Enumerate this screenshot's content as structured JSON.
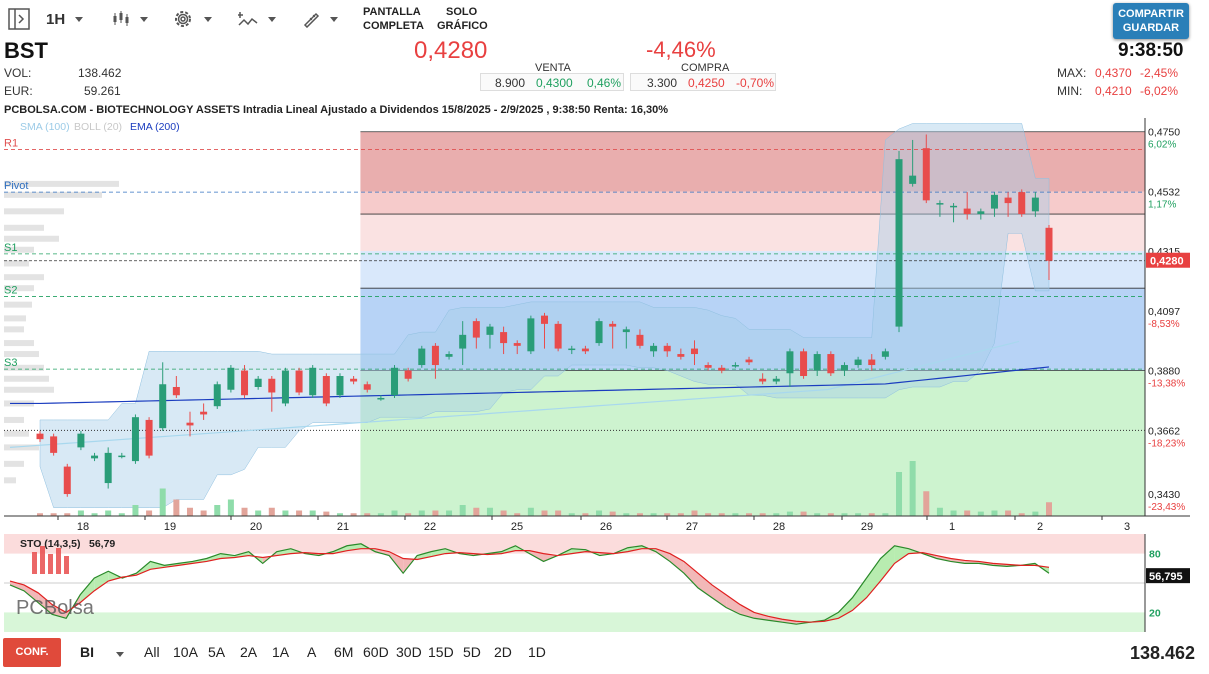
{
  "toolbar": {
    "timeframe": "1H",
    "mode_fullscreen": [
      "PANTALLA",
      "COMPLETA"
    ],
    "mode_chart_only": [
      "SOLO",
      "GRÁFICO"
    ],
    "share": [
      "COMPARTIR",
      "GUARDAR"
    ],
    "icons": [
      "panel-toggle-icon",
      "candles-icon",
      "gear-icon",
      "indicators-icon",
      "draw-pen-icon"
    ]
  },
  "quote": {
    "ticker": "BST",
    "vol_label": "VOL:",
    "vol": "138.462",
    "eur_label": "EUR:",
    "eur": "59.261",
    "price": "0,4280",
    "change": "-4,46%",
    "time": "9:38:50",
    "sell": {
      "label": "VENTA",
      "qty": "8.900",
      "price": "0,4300",
      "pct": "0,46%"
    },
    "buy": {
      "label": "COMPRA",
      "qty": "3.300",
      "price": "0,4250",
      "pct": "-0,70%"
    },
    "max_label": "MAX:",
    "max": "0,4370",
    "max_pct": "-2,45%",
    "min_label": "MIN:",
    "min": "0,4210",
    "min_pct": "-6,02%"
  },
  "chart_title": "PCBOLSA.COM - BIOTECHNOLOGY ASSETS Intradia Lineal Ajustado a Dividendos 15/8/2025 - 2/9/2025 , 9:38:50 Renta: 16,30%",
  "legend": {
    "sma": "SMA (100)",
    "boll": "BOLL (20)",
    "ema": "EMA (200)"
  },
  "pivots": [
    {
      "name": "R1",
      "value": 0.4685,
      "color": "#e05050"
    },
    {
      "name": "Pivot",
      "value": 0.453,
      "color": "#3070c0"
    },
    {
      "name": "S1",
      "value": 0.4305,
      "color": "#20a060"
    },
    {
      "name": "S2",
      "value": 0.415,
      "color": "#20a060"
    },
    {
      "name": "S3",
      "value": 0.3885,
      "color": "#20a060"
    }
  ],
  "chart_data": {
    "type": "candlestick",
    "ylim": [
      0.335,
      0.48
    ],
    "y_ticks": [
      {
        "value": 0.475,
        "label": "0,4750",
        "pct": "6,02%"
      },
      {
        "value": 0.4532,
        "label": "0,4532",
        "pct": "1,17%"
      },
      {
        "value": 0.4315,
        "label": "0,4315",
        "pct": ""
      },
      {
        "value": 0.4097,
        "label": "0,4097",
        "pct": "-8,53%"
      },
      {
        "value": 0.388,
        "label": "0,3880",
        "pct": "-13,38%"
      },
      {
        "value": 0.3662,
        "label": "0,3662",
        "pct": "-18,23%"
      },
      {
        "value": 0.343,
        "label": "0,3430",
        "pct": "-23,43%"
      }
    ],
    "last_price": {
      "value": 0.428,
      "label": "0,4280"
    },
    "x_ticks": [
      "18",
      "19",
      "20",
      "21",
      "22",
      "25",
      "26",
      "27",
      "28",
      "29",
      "1",
      "2",
      "3"
    ],
    "candles": [
      [
        0.365,
        0.363,
        0.366,
        0.362
      ],
      [
        0.364,
        0.358,
        0.365,
        0.357
      ],
      [
        0.353,
        0.343,
        0.354,
        0.342
      ],
      [
        0.36,
        0.365,
        0.366,
        0.359
      ],
      [
        0.356,
        0.357,
        0.358,
        0.355
      ],
      [
        0.347,
        0.358,
        0.36,
        0.345
      ],
      [
        0.357,
        0.357,
        0.358,
        0.356
      ],
      [
        0.355,
        0.371,
        0.372,
        0.354
      ],
      [
        0.37,
        0.357,
        0.371,
        0.356
      ],
      [
        0.367,
        0.383,
        0.391,
        0.366
      ],
      [
        0.382,
        0.379,
        0.386,
        0.378
      ],
      [
        0.369,
        0.368,
        0.373,
        0.364
      ],
      [
        0.373,
        0.372,
        0.376,
        0.37
      ],
      [
        0.375,
        0.383,
        0.384,
        0.374
      ],
      [
        0.381,
        0.389,
        0.39,
        0.38
      ],
      [
        0.388,
        0.379,
        0.39,
        0.378
      ],
      [
        0.382,
        0.385,
        0.386,
        0.381
      ],
      [
        0.385,
        0.38,
        0.386,
        0.373
      ],
      [
        0.376,
        0.388,
        0.389,
        0.375
      ],
      [
        0.388,
        0.38,
        0.389,
        0.379
      ],
      [
        0.379,
        0.389,
        0.39,
        0.378
      ],
      [
        0.386,
        0.376,
        0.387,
        0.375
      ],
      [
        0.379,
        0.386,
        0.387,
        0.378
      ],
      [
        0.385,
        0.384,
        0.386,
        0.383
      ],
      [
        0.383,
        0.381,
        0.384,
        0.38
      ],
      [
        0.378,
        0.378,
        0.379,
        0.377
      ],
      [
        0.379,
        0.389,
        0.39,
        0.378
      ],
      [
        0.388,
        0.385,
        0.389,
        0.384
      ],
      [
        0.39,
        0.396,
        0.397,
        0.389
      ],
      [
        0.397,
        0.39,
        0.398,
        0.385
      ],
      [
        0.393,
        0.394,
        0.395,
        0.392
      ],
      [
        0.396,
        0.401,
        0.406,
        0.39
      ],
      [
        0.406,
        0.4,
        0.407,
        0.396
      ],
      [
        0.401,
        0.404,
        0.405,
        0.396
      ],
      [
        0.402,
        0.398,
        0.404,
        0.394
      ],
      [
        0.398,
        0.397,
        0.399,
        0.394
      ],
      [
        0.395,
        0.407,
        0.408,
        0.394
      ],
      [
        0.408,
        0.405,
        0.409,
        0.396
      ],
      [
        0.405,
        0.396,
        0.406,
        0.395
      ],
      [
        0.396,
        0.396,
        0.397,
        0.394
      ],
      [
        0.396,
        0.395,
        0.397,
        0.394
      ],
      [
        0.398,
        0.406,
        0.407,
        0.397
      ],
      [
        0.405,
        0.404,
        0.406,
        0.396
      ],
      [
        0.402,
        0.403,
        0.404,
        0.396
      ],
      [
        0.401,
        0.397,
        0.403,
        0.396
      ],
      [
        0.395,
        0.397,
        0.398,
        0.393
      ],
      [
        0.397,
        0.395,
        0.398,
        0.393
      ],
      [
        0.394,
        0.393,
        0.396,
        0.392
      ],
      [
        0.396,
        0.394,
        0.399,
        0.39
      ],
      [
        0.39,
        0.389,
        0.391,
        0.388
      ],
      [
        0.389,
        0.388,
        0.39,
        0.387
      ],
      [
        0.39,
        0.39,
        0.391,
        0.389
      ],
      [
        0.392,
        0.391,
        0.393,
        0.39
      ],
      [
        0.385,
        0.384,
        0.387,
        0.383
      ],
      [
        0.384,
        0.385,
        0.386,
        0.383
      ],
      [
        0.387,
        0.395,
        0.396,
        0.382
      ],
      [
        0.395,
        0.386,
        0.396,
        0.385
      ],
      [
        0.388,
        0.394,
        0.395,
        0.386
      ],
      [
        0.394,
        0.387,
        0.395,
        0.386
      ],
      [
        0.388,
        0.39,
        0.391,
        0.386
      ],
      [
        0.39,
        0.392,
        0.393,
        0.389
      ],
      [
        0.392,
        0.39,
        0.394,
        0.388
      ],
      [
        0.393,
        0.395,
        0.396,
        0.392
      ],
      [
        0.404,
        0.465,
        0.468,
        0.402
      ],
      [
        0.456,
        0.459,
        0.472,
        0.455
      ],
      [
        0.469,
        0.45,
        0.474,
        0.449
      ],
      [
        0.449,
        0.449,
        0.45,
        0.444
      ],
      [
        0.448,
        0.448,
        0.449,
        0.442
      ],
      [
        0.447,
        0.445,
        0.453,
        0.443
      ],
      [
        0.445,
        0.446,
        0.447,
        0.443
      ],
      [
        0.447,
        0.452,
        0.453,
        0.444
      ],
      [
        0.451,
        0.449,
        0.453,
        0.444
      ],
      [
        0.453,
        0.445,
        0.454,
        0.444
      ],
      [
        0.446,
        0.451,
        0.453,
        0.444
      ],
      [
        0.44,
        0.428,
        0.441,
        0.421
      ]
    ],
    "volume": [
      0.05,
      0.05,
      0.05,
      0.1,
      0.05,
      0.1,
      0.05,
      0.2,
      0.1,
      0.5,
      0.3,
      0.15,
      0.1,
      0.2,
      0.3,
      0.15,
      0.1,
      0.15,
      0.1,
      0.1,
      0.1,
      0.08,
      0.05,
      0.05,
      0.05,
      0.05,
      0.1,
      0.05,
      0.1,
      0.1,
      0.1,
      0.2,
      0.15,
      0.15,
      0.1,
      0.05,
      0.15,
      0.1,
      0.1,
      0.05,
      0.05,
      0.1,
      0.08,
      0.05,
      0.05,
      0.05,
      0.05,
      0.05,
      0.1,
      0.05,
      0.05,
      0.05,
      0.05,
      0.05,
      0.05,
      0.08,
      0.08,
      0.05,
      0.05,
      0.05,
      0.05,
      0.05,
      0.05,
      0.8,
      1.0,
      0.45,
      0.15,
      0.1,
      0.1,
      0.08,
      0.1,
      0.1,
      0.05,
      0.08,
      0.25
    ],
    "ema200": [
      0.376,
      0.3845
    ],
    "sto": {
      "label": "STO (14,3,5)",
      "value_label": "56,79",
      "current": "56,795",
      "levels": [
        80,
        20
      ],
      "ylim": [
        0,
        100
      ],
      "k": [
        48,
        42,
        30,
        18,
        14,
        38,
        55,
        62,
        55,
        60,
        72,
        68,
        70,
        72,
        75,
        80,
        78,
        82,
        70,
        82,
        85,
        80,
        78,
        82,
        88,
        90,
        82,
        78,
        60,
        78,
        82,
        85,
        80,
        78,
        80,
        82,
        88,
        80,
        72,
        78,
        85,
        84,
        78,
        80,
        86,
        88,
        82,
        72,
        60,
        45,
        35,
        25,
        18,
        14,
        12,
        10,
        8,
        10,
        12,
        20,
        35,
        55,
        75,
        88,
        85,
        80,
        75,
        72,
        70,
        70,
        68,
        67,
        68,
        70,
        60
      ],
      "d": [
        52,
        48,
        40,
        28,
        20,
        30,
        42,
        52,
        56,
        58,
        64,
        66,
        68,
        70,
        72,
        75,
        76,
        78,
        76,
        78,
        80,
        81,
        80,
        80,
        83,
        85,
        85,
        82,
        75,
        74,
        77,
        80,
        81,
        80,
        79,
        80,
        83,
        83,
        80,
        78,
        80,
        82,
        81,
        80,
        82,
        85,
        85,
        80,
        72,
        60,
        48,
        38,
        28,
        20,
        16,
        13,
        11,
        10,
        11,
        14,
        22,
        35,
        52,
        70,
        80,
        81,
        78,
        75,
        73,
        72,
        70,
        69,
        68,
        68,
        66
      ]
    }
  },
  "brand": {
    "logo": "PCBolsa"
  },
  "bottom": {
    "config": "CONF.",
    "type": "BI",
    "ranges": [
      "All",
      "10A",
      "5A",
      "2A",
      "1A",
      "A",
      "6M",
      "60D",
      "30D",
      "15D",
      "5D",
      "2D",
      "1D"
    ],
    "total_volume": "138.462"
  },
  "colors": {
    "up": "#2a9d78",
    "down": "#e84c4c",
    "ema": "#1a3cbf",
    "sma": "#a8d8ee"
  }
}
